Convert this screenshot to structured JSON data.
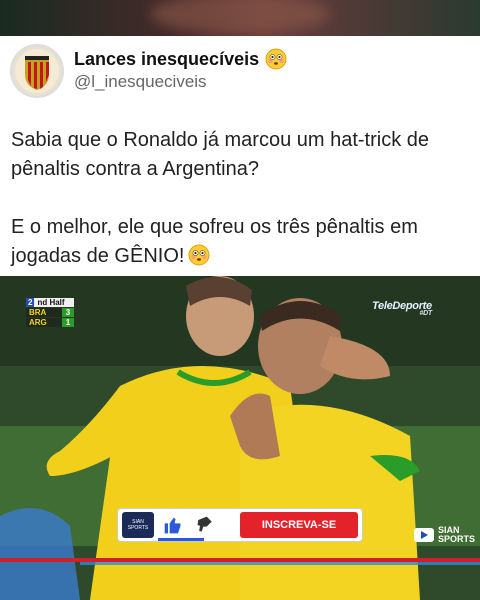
{
  "post": {
    "display_name": "Lances inesquecíveis",
    "handle": "@l_inesqueciveis",
    "paragraphs": [
      "Sabia que o Ronaldo já marcou um hat-trick de pênaltis contra a Argentina?",
      "E o melhor, ele que sofreu os três pênaltis em jogadas de GÊNIO!"
    ],
    "name_emoji": "flushed-face-emoji",
    "text_emoji": "flushed-face-emoji"
  },
  "video": {
    "scoreboard": {
      "period_number": "2",
      "period_label": "nd Half",
      "home_team": "BRA",
      "home_score": "3",
      "away_team": "ARG",
      "away_score": "1"
    },
    "channel_logo": "TeleDeporte",
    "channel_logo_sub": "#DT",
    "subscribe_bar": {
      "channel_badge": "SIAN SPORTS",
      "like_icon": "thumbs-up-icon",
      "dislike_icon": "thumbs-down-icon",
      "subscribe_label": "INSCREVA-SE"
    },
    "watermark": {
      "line1": "SIAN",
      "line2": "SPORTS"
    }
  },
  "colors": {
    "subscribe_red": "#e3222a",
    "brazil_yellow": "#f2d21e",
    "brazil_green": "#2a9c2a"
  }
}
